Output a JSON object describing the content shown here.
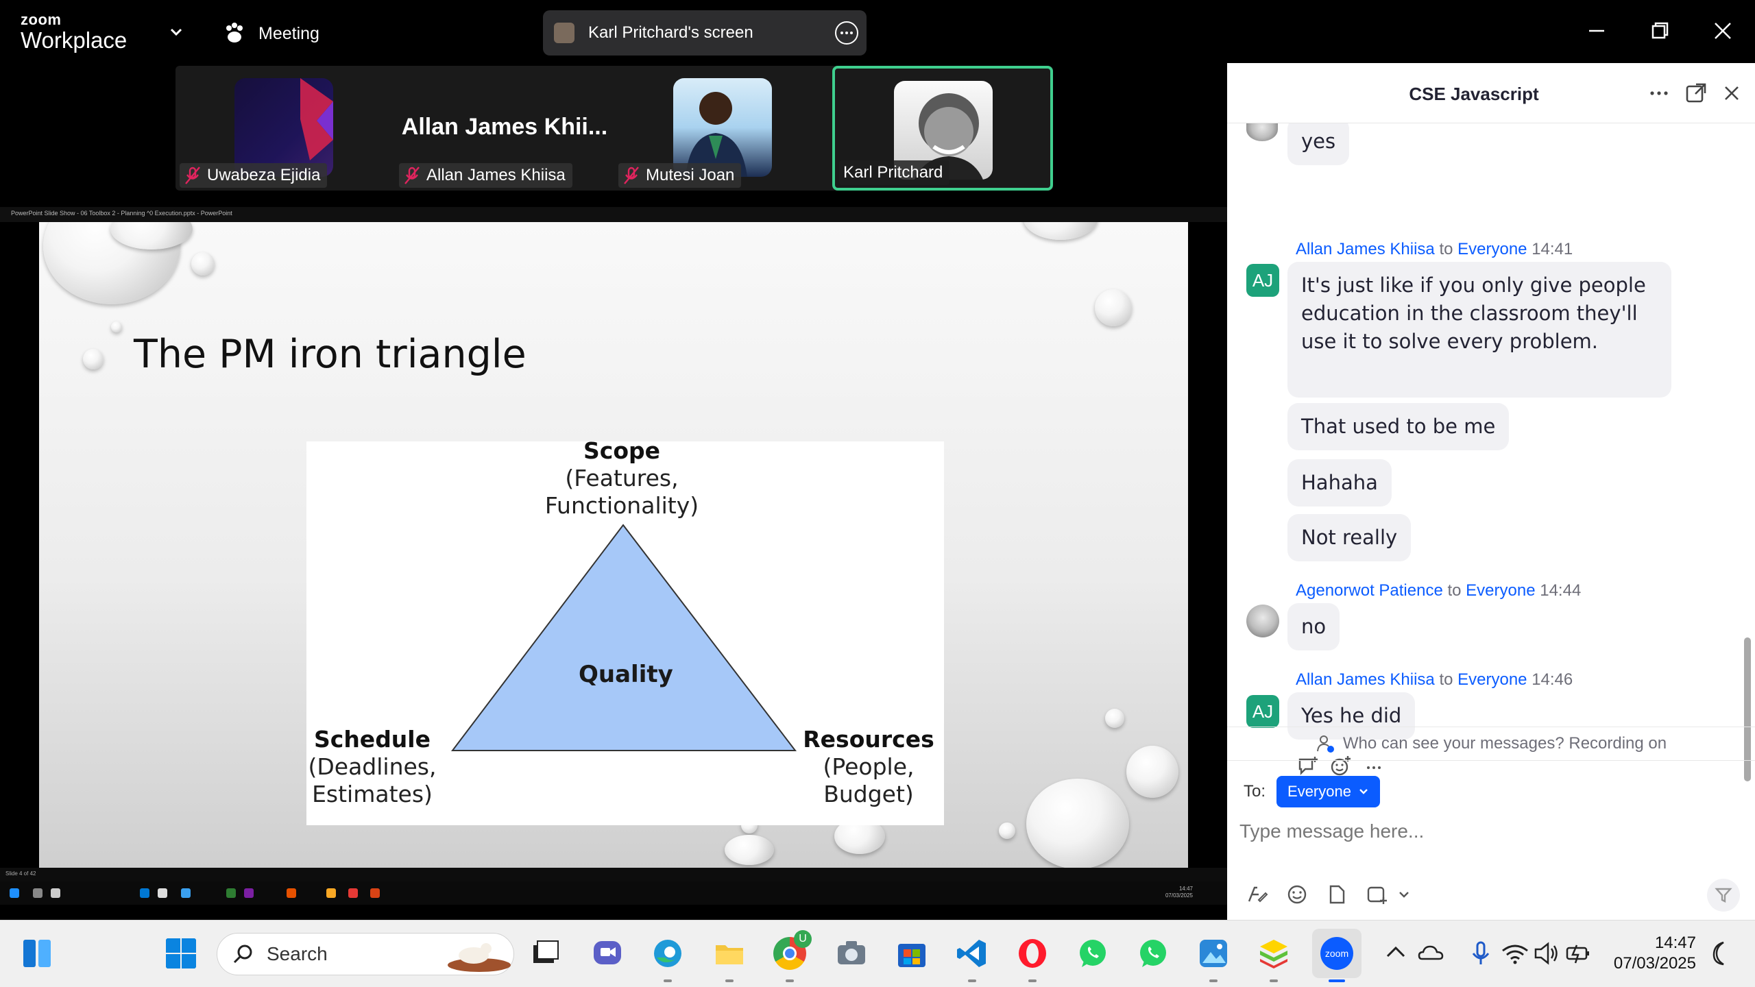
{
  "app": {
    "brand_small": "zoom",
    "brand_big": "Workplace",
    "meeting_label": "Meeting",
    "share_label": "Karl Pritchard's screen"
  },
  "participants": [
    {
      "name": "Uwabeza Ejidia",
      "muted": true
    },
    {
      "name": "Allan James Khiisa",
      "display_big": "Allan James Khii...",
      "muted": true
    },
    {
      "name": "Mutesi Joan",
      "muted": true
    },
    {
      "name": "Karl Pritchard",
      "muted": false,
      "active": true
    }
  ],
  "powerpoint": {
    "window_title": "PowerPoint Slide Show - 06 Toolbox 2 - Planning ^0 Execution.pptx - PowerPoint",
    "status": "Slide 4 of 42"
  },
  "slide": {
    "title": "The PM iron triangle",
    "top_label": "Scope",
    "top_sub1": "(Features,",
    "top_sub2": "Functionality)",
    "left_label": "Schedule",
    "left_sub1": "(Deadlines,",
    "left_sub2": "Estimates)",
    "right_label": "Resources",
    "right_sub1": "(People,",
    "right_sub2": "Budget)",
    "center_label": "Quality"
  },
  "chat": {
    "title": "CSE Javascript",
    "to_label": "To:",
    "recipient": "Everyone",
    "placeholder": "Type message here...",
    "privacy": "Who can see your messages? Recording on",
    "messages": [
      {
        "text": "yes"
      },
      {
        "sender": "Allan James Khiisa",
        "to": "to",
        "target": "Everyone",
        "time": "14:41",
        "initials": "AJ"
      },
      {
        "text": "It's just like if you only give people education in the classroom they'll use it to solve every problem."
      },
      {
        "text": "That used to be me"
      },
      {
        "text": "Hahaha"
      },
      {
        "text": "Not really"
      },
      {
        "sender": "Agenorwot Patience",
        "to": "to",
        "target": "Everyone",
        "time": "14:44"
      },
      {
        "text": "no"
      },
      {
        "sender": "Allan James Khiisa",
        "to": "to",
        "target": "Everyone",
        "time": "14:46",
        "initials": "AJ"
      },
      {
        "text": "Yes he did"
      }
    ]
  },
  "taskbar": {
    "search_label": "Search",
    "time": "14:47",
    "date": "07/03/2025",
    "chrome_badge": "U",
    "zoom_label": "zoom",
    "inner_time": "14:47",
    "inner_date": "07/03/2025"
  },
  "colors": {
    "zoom_blue": "#0b5cff",
    "active_border": "#3fcf8e",
    "triangle_fill": "#a6c8f8"
  }
}
